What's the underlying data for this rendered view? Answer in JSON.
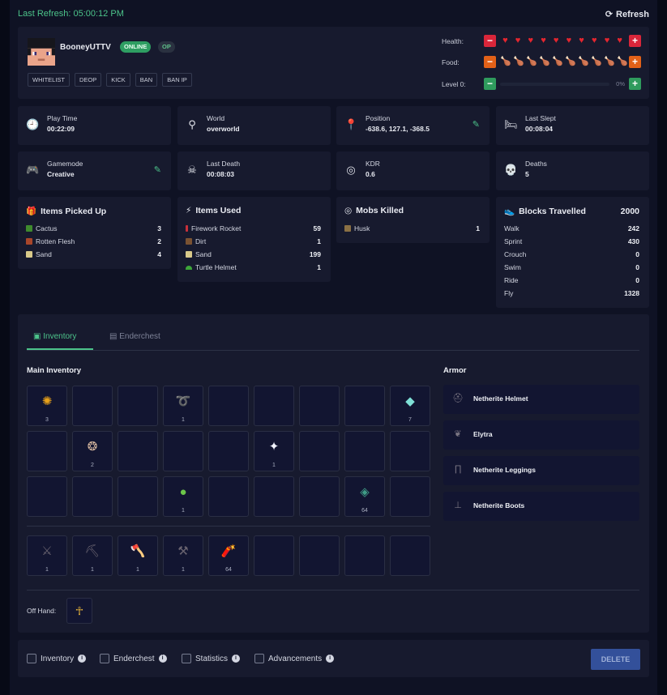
{
  "header": {
    "last_refresh": "Last Refresh: 05:00:12 PM",
    "refresh_label": "Refresh"
  },
  "player": {
    "name": "BooneyUTTV",
    "status_badge": "ONLINE",
    "op_badge": "OP",
    "actions": [
      "WHITELIST",
      "DEOP",
      "KICK",
      "BAN",
      "BAN IP"
    ],
    "health_label": "Health:",
    "health": {
      "value": 10,
      "max": 10
    },
    "food_label": "Food:",
    "food": {
      "value": 7,
      "max": 10
    },
    "level_label": "Level 0:",
    "level_progress": "0%"
  },
  "info_cards": [
    {
      "title": "Play Time",
      "value": "00:22:09",
      "icon": "clock-icon"
    },
    {
      "title": "World",
      "value": "overworld",
      "icon": "location-pin-icon"
    },
    {
      "title": "Position",
      "value": "-638.6, 127.1, -368.5",
      "icon": "map-pin-icon",
      "editable": true
    },
    {
      "title": "Last Slept",
      "value": "00:08:04",
      "icon": "bed-icon"
    },
    {
      "title": "Gamemode",
      "value": "Creative",
      "icon": "gamepad-icon",
      "editable": true
    },
    {
      "title": "Last Death",
      "value": "00:08:03",
      "icon": "skull-crossbones-icon"
    },
    {
      "title": "KDR",
      "value": "0.6",
      "icon": "target-icon"
    },
    {
      "title": "Deaths",
      "value": "5",
      "icon": "skull-icon"
    }
  ],
  "items_picked_up": {
    "title": "Items Picked Up",
    "rows": [
      {
        "name": "Cactus",
        "value": "3",
        "color": "#3f8a2e"
      },
      {
        "name": "Rotten Flesh",
        "value": "2",
        "color": "#a8462a"
      },
      {
        "name": "Sand",
        "value": "4",
        "color": "#d8c98a"
      }
    ]
  },
  "items_used": {
    "title": "Items Used",
    "rows": [
      {
        "name": "Firework Rocket",
        "value": "59",
        "color": "#c8303a"
      },
      {
        "name": "Dirt",
        "value": "1",
        "color": "#7a5232"
      },
      {
        "name": "Sand",
        "value": "199",
        "color": "#d8c98a"
      },
      {
        "name": "Turtle Helmet",
        "value": "1",
        "color": "#3da53a"
      }
    ]
  },
  "mobs_killed": {
    "title": "Mobs Killed",
    "rows": [
      {
        "name": "Husk",
        "value": "1",
        "color": "#8a7044"
      }
    ]
  },
  "blocks_travelled": {
    "title": "Blocks Travelled",
    "total": "2000",
    "rows": [
      {
        "name": "Walk",
        "value": "242"
      },
      {
        "name": "Sprint",
        "value": "430"
      },
      {
        "name": "Crouch",
        "value": "0"
      },
      {
        "name": "Swim",
        "value": "0"
      },
      {
        "name": "Ride",
        "value": "0"
      },
      {
        "name": "Fly",
        "value": "1328"
      }
    ]
  },
  "inventory": {
    "tabs": [
      "Inventory",
      "Enderchest"
    ],
    "main_title": "Main Inventory",
    "main": [
      {
        "slot": 0,
        "icon": "honeycomb-icon",
        "glyph": "✺",
        "color": "#e9a21a",
        "count": "3"
      },
      {
        "slot": 3,
        "icon": "lead-icon",
        "glyph": "➰",
        "color": "#d8dbe4",
        "count": "1"
      },
      {
        "slot": 8,
        "icon": "diamond-icon",
        "glyph": "◆",
        "color": "#7fe0d6",
        "count": "7"
      },
      {
        "slot": 10,
        "icon": "nautilus-shell-icon",
        "glyph": "❂",
        "color": "#d9b9a0",
        "count": "2"
      },
      {
        "slot": 14,
        "icon": "nether-star-icon",
        "glyph": "✦",
        "color": "#f2f4ff",
        "count": "1"
      },
      {
        "slot": 21,
        "icon": "slime-ball-icon",
        "glyph": "●",
        "color": "#6cc64a",
        "count": "1"
      },
      {
        "slot": 25,
        "icon": "prismarine-shard-icon",
        "glyph": "◈",
        "color": "#3f9c86",
        "count": "64"
      }
    ],
    "hotbar": [
      {
        "slot": 0,
        "icon": "netherite-sword-icon",
        "glyph": "⚔",
        "color": "#6a6470",
        "count": "1"
      },
      {
        "slot": 1,
        "icon": "netherite-pickaxe-icon",
        "glyph": "⛏",
        "color": "#6a6470",
        "count": "1"
      },
      {
        "slot": 2,
        "icon": "netherite-axe-icon",
        "glyph": "🪓",
        "color": "#6a6470",
        "count": "1"
      },
      {
        "slot": 3,
        "icon": "netherite-shovel-icon",
        "glyph": "⚒",
        "color": "#6a6470",
        "count": "1"
      },
      {
        "slot": 4,
        "icon": "firework-rocket-icon",
        "glyph": "🧨",
        "color": "#d53b3b",
        "count": "64"
      }
    ],
    "armor_title": "Armor",
    "armor": [
      {
        "name": "Netherite Helmet",
        "icon": "netherite-helmet-icon",
        "glyph": "⛑"
      },
      {
        "name": "Elytra",
        "icon": "elytra-icon",
        "glyph": "❦"
      },
      {
        "name": "Netherite Leggings",
        "icon": "netherite-leggings-icon",
        "glyph": "∏"
      },
      {
        "name": "Netherite Boots",
        "icon": "netherite-boots-icon",
        "glyph": "⊥"
      }
    ],
    "offhand_label": "Off Hand:",
    "offhand": {
      "icon": "totem-of-undying-icon",
      "glyph": "☥",
      "color": "#e7b43a"
    }
  },
  "delete_options": [
    "Inventory",
    "Enderchest",
    "Statistics",
    "Advancements"
  ],
  "delete_label": "DELETE",
  "colors": {
    "accent": "#4cc38a",
    "danger": "#d9263a",
    "warning": "#e26118",
    "panel": "#171a2e"
  }
}
